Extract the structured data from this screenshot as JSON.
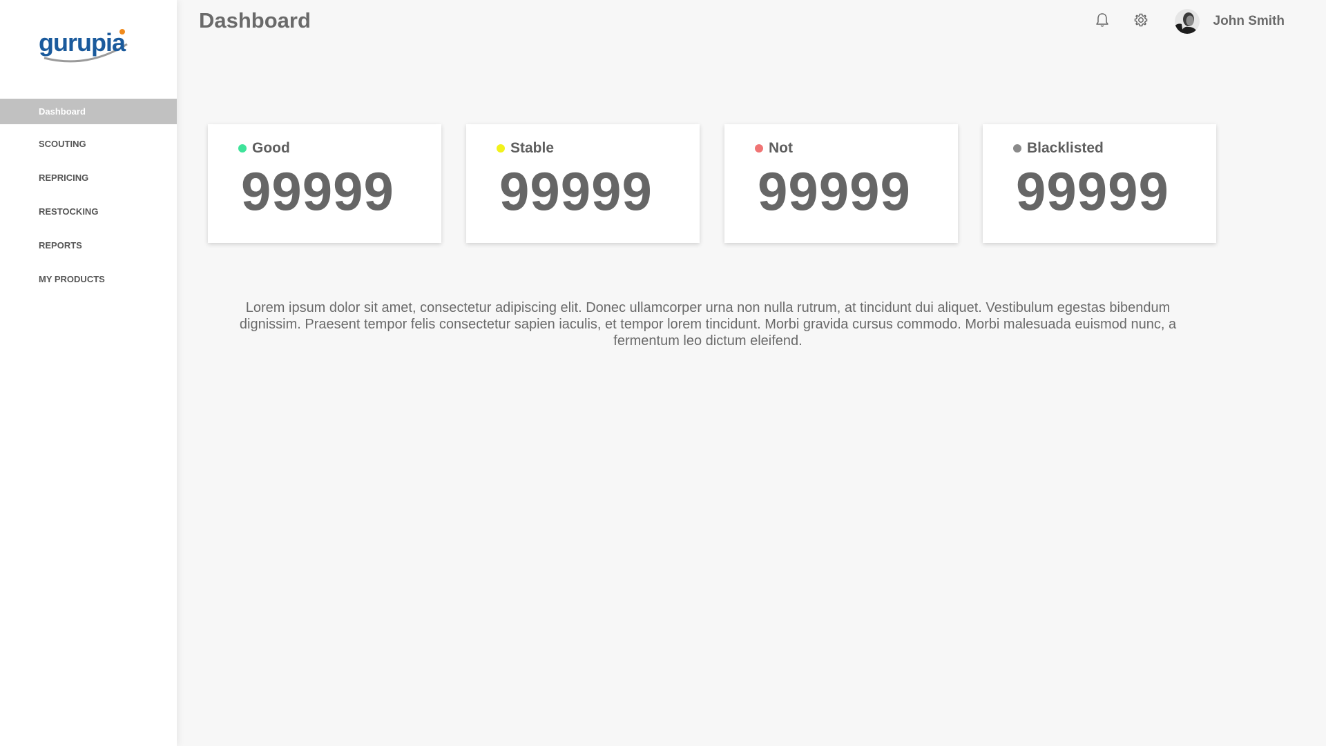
{
  "app": {
    "logo_text": "gurupia",
    "colors": {
      "logo_blue": "#1a5a9c",
      "logo_orange": "#f08a1c",
      "sidebar_active": "#c1c1c1"
    }
  },
  "sidebar": {
    "items": [
      {
        "label": "Dashboard",
        "active": true
      },
      {
        "label": "SCOUTING",
        "active": false
      },
      {
        "label": "REPRICING",
        "active": false
      },
      {
        "label": "RESTOCKING",
        "active": false
      },
      {
        "label": "REPORTS",
        "active": false
      },
      {
        "label": "MY PRODUCTS",
        "active": false
      }
    ]
  },
  "header": {
    "title": "Dashboard",
    "icons": [
      "bell-icon",
      "gear-icon"
    ],
    "user": {
      "name": "John Smith"
    }
  },
  "stats": [
    {
      "label": "Good",
      "value": "99999",
      "color": "#3ee39a"
    },
    {
      "label": "Stable",
      "value": "99999",
      "color": "#f2f21b"
    },
    {
      "label": "Not",
      "value": "99999",
      "color": "#f07474"
    },
    {
      "label": "Blacklisted",
      "value": "99999",
      "color": "#8a8a8a"
    }
  ],
  "description": "Lorem ipsum dolor sit amet, consectetur adipiscing elit. Donec ullamcorper urna non nulla rutrum, at tincidunt dui aliquet. Vestibulum egestas bibendum dignissim. Praesent tempor felis consectetur sapien iaculis, et tempor lorem tincidunt. Morbi gravida cursus commodo. Morbi malesuada euismod nunc, a fermentum leo dictum eleifend."
}
